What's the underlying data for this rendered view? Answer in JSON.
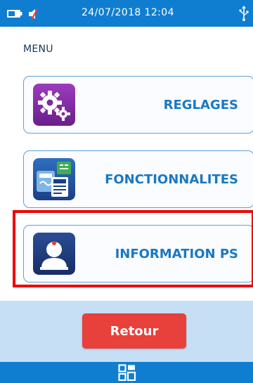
{
  "status_bar": {
    "datetime": "24/07/2018 12:04",
    "icons": [
      "battery-icon",
      "mute-icon",
      "usb-icon"
    ]
  },
  "menu": {
    "title": "MENU",
    "items": [
      {
        "label": "REGLAGES",
        "icon": "settings-gears-icon"
      },
      {
        "label": "FONCTIONNALITES",
        "icon": "features-icon"
      },
      {
        "label": "INFORMATION PS",
        "icon": "user-profile-icon",
        "highlighted": true
      }
    ]
  },
  "footer": {
    "back_label": "Retour",
    "nav_icon": "apps-grid-icon"
  },
  "colors": {
    "bar": "#0f7ed0",
    "accent_text": "#1a78c2",
    "back_button": "#e8403a",
    "highlight": "#ee0000",
    "footer_panel": "#c6dff5"
  }
}
